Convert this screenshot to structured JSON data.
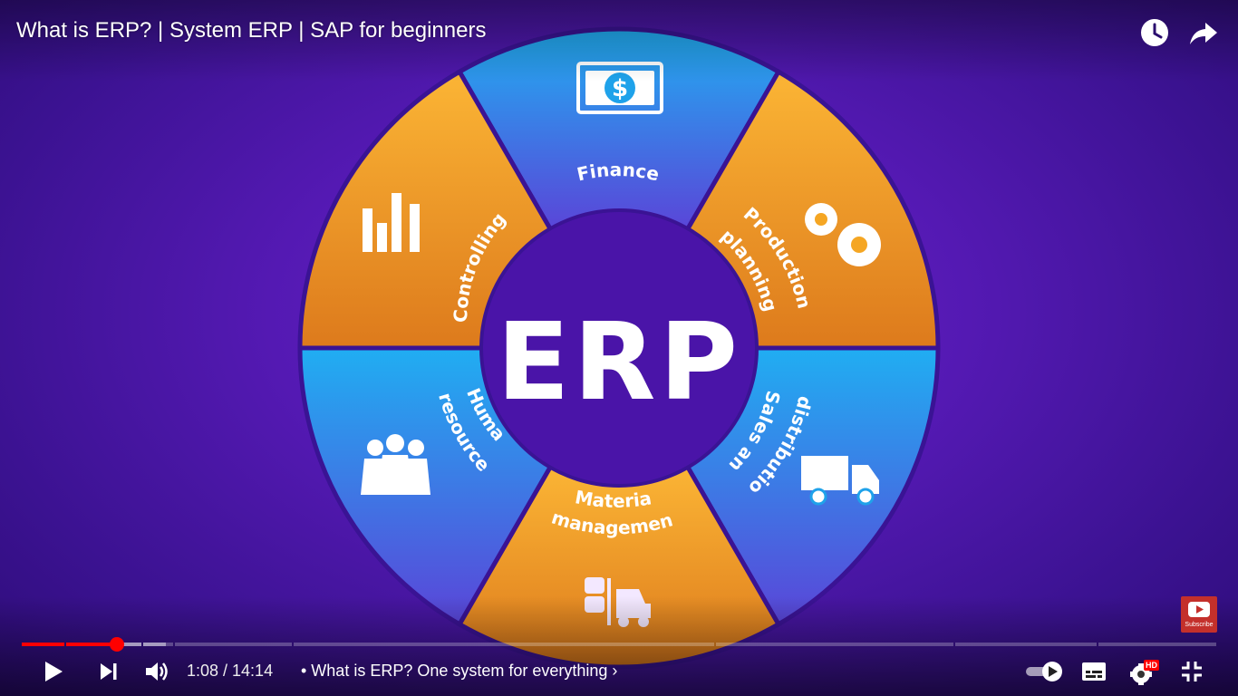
{
  "video": {
    "title": "What is ERP? | System ERP | SAP for beginners"
  },
  "diagram": {
    "center_label": "ERP",
    "segments": [
      {
        "name": "finance",
        "label_lines": [
          "Finance"
        ],
        "icon": "dollar-bill-icon",
        "color": "blue"
      },
      {
        "name": "production-planning",
        "label_lines": [
          "Production",
          "planning"
        ],
        "icon": "gears-icon",
        "color": "orange"
      },
      {
        "name": "sales-distribution",
        "label_lines": [
          "Sales and",
          "distribution"
        ],
        "icon": "truck-icon",
        "color": "blue"
      },
      {
        "name": "material-management",
        "label_lines": [
          "Material",
          "management"
        ],
        "icon": "forklift-icon",
        "color": "orange"
      },
      {
        "name": "human-resources",
        "label_lines": [
          "Human",
          "resources"
        ],
        "icon": "people-icon",
        "color": "blue"
      },
      {
        "name": "controlling",
        "label_lines": [
          "Controlling"
        ],
        "icon": "bar-chart-icon",
        "color": "orange"
      }
    ],
    "colors": {
      "blue": "#1fa2ea",
      "orange": "#f5a623",
      "center": "#4a14a8",
      "gap": "#3a1394"
    }
  },
  "player": {
    "current_time": "1:08",
    "duration": "14:14",
    "time_text": "1:08 / 14:14",
    "chapter_text": "• What is ERP? One system for everything ›",
    "progress_fraction": 0.08,
    "buffered_fraction": 0.12,
    "hd_badge": "HD",
    "subscribe_label": "Subscribe",
    "colors": {
      "progress": "#ff0000"
    }
  }
}
